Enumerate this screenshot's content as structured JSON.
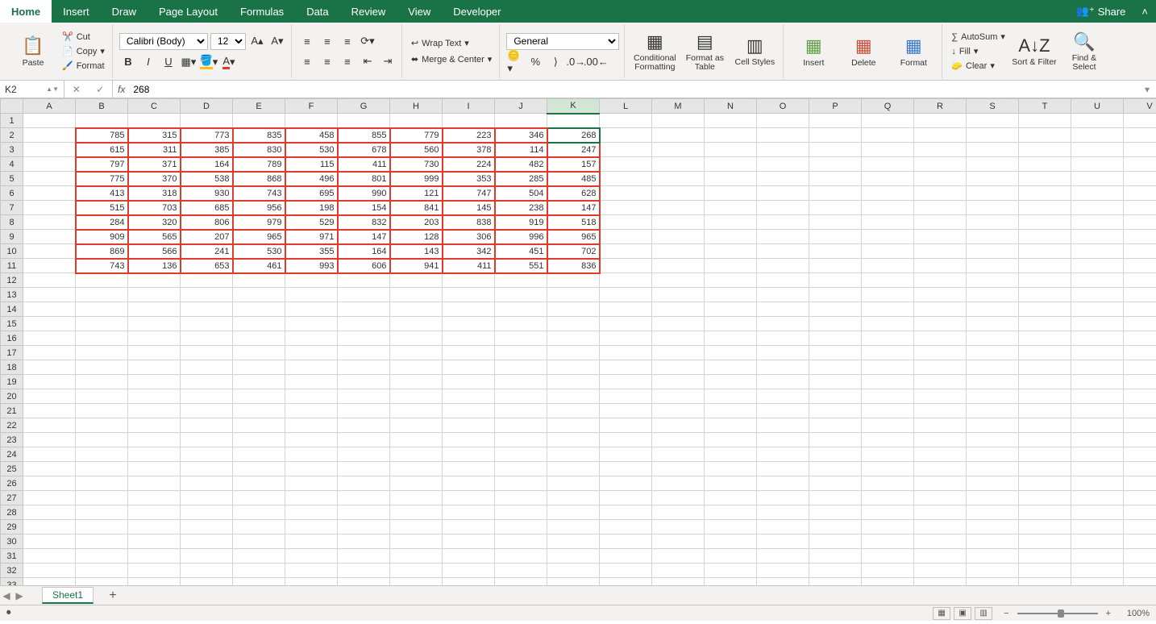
{
  "tabs": [
    "Home",
    "Insert",
    "Draw",
    "Page Layout",
    "Formulas",
    "Data",
    "Review",
    "View",
    "Developer"
  ],
  "share_label": "Share",
  "clipboard": {
    "paste": "Paste",
    "cut": "Cut",
    "copy": "Copy",
    "format": "Format"
  },
  "font": {
    "name": "Calibri (Body)",
    "size": "12"
  },
  "align": {
    "wrap": "Wrap Text",
    "merge": "Merge & Center"
  },
  "number": {
    "format": "General"
  },
  "styles": {
    "cond": "Conditional Formatting",
    "table": "Format as Table",
    "cell": "Cell Styles"
  },
  "cells": {
    "insert": "Insert",
    "delete": "Delete",
    "format": "Format"
  },
  "editing": {
    "sum": "AutoSum",
    "fill": "Fill",
    "clear": "Clear",
    "sort": "Sort & Filter",
    "find": "Find & Select"
  },
  "namebox": "K2",
  "formula": "268",
  "columns": [
    "A",
    "B",
    "C",
    "D",
    "E",
    "F",
    "G",
    "H",
    "I",
    "J",
    "K",
    "L",
    "M",
    "N",
    "O",
    "P",
    "Q",
    "R",
    "S",
    "T",
    "U",
    "V"
  ],
  "row_count": 35,
  "active_cell": {
    "row": 2,
    "col": "K"
  },
  "data_rows": [
    [
      785,
      315,
      773,
      835,
      458,
      855,
      779,
      223,
      346,
      268
    ],
    [
      615,
      311,
      385,
      830,
      530,
      678,
      560,
      378,
      114,
      247
    ],
    [
      797,
      371,
      164,
      789,
      115,
      411,
      730,
      224,
      482,
      157
    ],
    [
      775,
      370,
      538,
      868,
      496,
      801,
      999,
      353,
      285,
      485
    ],
    [
      413,
      318,
      930,
      743,
      695,
      990,
      121,
      747,
      504,
      628
    ],
    [
      515,
      703,
      685,
      956,
      198,
      154,
      841,
      145,
      238,
      147
    ],
    [
      284,
      320,
      806,
      979,
      529,
      832,
      203,
      838,
      919,
      518
    ],
    [
      909,
      565,
      207,
      965,
      971,
      147,
      128,
      306,
      996,
      965
    ],
    [
      869,
      566,
      241,
      530,
      355,
      164,
      143,
      342,
      451,
      702
    ],
    [
      743,
      136,
      653,
      461,
      993,
      606,
      941,
      411,
      551,
      836
    ]
  ],
  "red_box_start_row": 2,
  "sheet_name": "Sheet1",
  "zoom": "100%"
}
